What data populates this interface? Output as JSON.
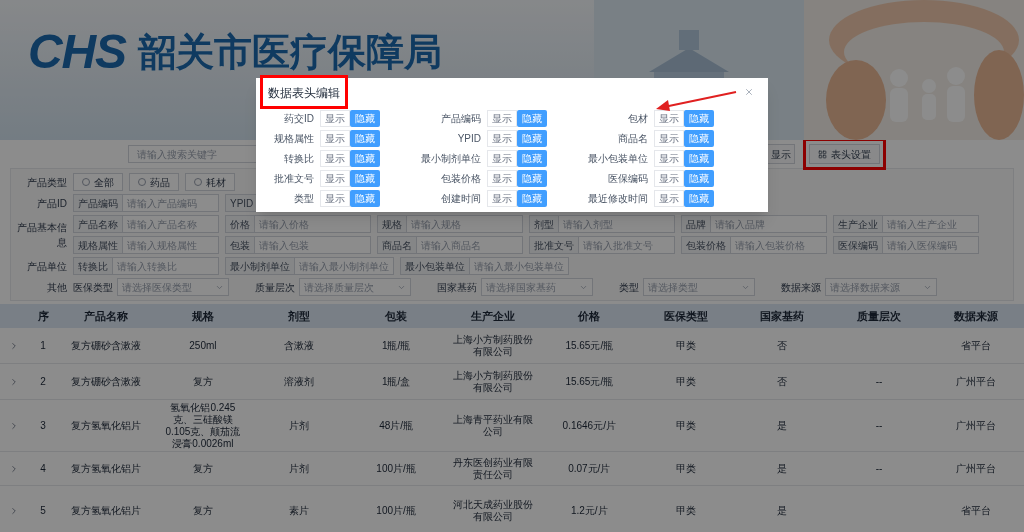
{
  "header": {
    "logo": "CHS",
    "title": "韶关市医疗保障局"
  },
  "toolbar": {
    "search": {
      "placeholder": "请输入搜索关键字"
    },
    "buttons": [
      {
        "kind": "plain",
        "label": "显示",
        "highlighted": false
      },
      {
        "kind": "columns",
        "label": "表头设置",
        "highlighted": true
      }
    ]
  },
  "filters": [
    {
      "kind": "radio",
      "label": "产品类型",
      "options": [
        {
          "label": "全部",
          "selected": false
        },
        {
          "label": "药品",
          "selected": false
        },
        {
          "label": "耗材",
          "selected": false
        }
      ]
    },
    {
      "kind": "inputs",
      "label": "产品ID",
      "lines": [
        [
          {
            "label": "产品编码",
            "placeholder": "请输入产品编码"
          },
          {
            "label": "YPID"
          }
        ]
      ]
    },
    {
      "kind": "inputs",
      "label": "产品基本信息",
      "lines": [
        [
          {
            "label": "产品名称",
            "placeholder": "请输入产品名称"
          },
          {
            "label": "价格",
            "placeholder": "请输入价格"
          },
          {
            "label": "规格",
            "placeholder": "请输入规格"
          },
          {
            "label": "剂型",
            "placeholder": "请输入剂型"
          },
          {
            "label": "品牌",
            "placeholder": "请输入品牌"
          },
          {
            "label": "生产企业",
            "placeholder": "请输入生产企业"
          }
        ],
        [
          {
            "label": "规格属性",
            "placeholder": "请输入规格属性"
          },
          {
            "label": "包装",
            "placeholder": "请输入包装"
          },
          {
            "label": "商品名",
            "placeholder": "请输入商品名"
          },
          {
            "label": "批准文号",
            "placeholder": "请输入批准文号"
          },
          {
            "label": "包装价格",
            "placeholder": "请输入包装价格"
          },
          {
            "label": "医保编码",
            "placeholder": "请输入医保编码"
          }
        ]
      ]
    },
    {
      "kind": "inputs",
      "label": "产品单位",
      "lines": [
        [
          {
            "label": "转换比",
            "placeholder": "请输入转换比"
          },
          {
            "label": "最小制剂单位",
            "placeholder": "请输入最小制剂单位"
          },
          {
            "label": "最小包装单位",
            "placeholder": "请输入最小包装单位"
          }
        ]
      ]
    },
    {
      "kind": "selects",
      "label": "其他",
      "fields": [
        {
          "label": "医保类型",
          "placeholder": "请选择医保类型"
        },
        {
          "label": "质量层次",
          "placeholder": "请选择质量层次"
        },
        {
          "label": "国家基药",
          "placeholder": "请选择国家基药"
        },
        {
          "label": "类型",
          "placeholder": "请选择类型"
        },
        {
          "label": "数据来源",
          "placeholder": "请选择数据来源"
        }
      ]
    }
  ],
  "table": {
    "columns": [
      "序",
      "产品名称",
      "规格",
      "剂型",
      "包装",
      "生产企业",
      "价格",
      "医保类型",
      "国家基药",
      "质量层次",
      "数据来源"
    ],
    "rows": [
      {
        "expanded": false,
        "cells": [
          "1",
          "复方硼砂含漱液",
          "250ml",
          "含漱液",
          "1瓶/瓶",
          "上海小方制药股份有限公司",
          "15.65元/瓶",
          "甲类",
          "否",
          "",
          "省平台"
        ]
      },
      {
        "expanded": false,
        "cells": [
          "2",
          "复方硼砂含漱液",
          "复方",
          "溶液剂",
          "1瓶/盒",
          "上海小方制药股份有限公司",
          "15.65元/瓶",
          "甲类",
          "否",
          "--",
          "广州平台"
        ]
      },
      {
        "expanded": false,
        "cells": [
          "3",
          "复方氢氧化铝片",
          "氢氧化铝0.245克、三硅酸镁0.105克、颠茄流浸膏0.0026ml",
          "片剂",
          "48片/瓶",
          "上海青平药业有限公司",
          "0.1646元/片",
          "甲类",
          "是",
          "--",
          "广州平台"
        ]
      },
      {
        "expanded": false,
        "cells": [
          "4",
          "复方氢氧化铝片",
          "复方",
          "片剂",
          "100片/瓶",
          "丹东医创药业有限责任公司",
          "0.07元/片",
          "甲类",
          "是",
          "--",
          "广州平台"
        ]
      },
      {
        "expanded": false,
        "cells": [
          "5",
          "复方氢氧化铝片",
          "复方",
          "素片",
          "100片/瓶",
          "河北天成药业股份有限公司",
          "1.2元/片",
          "甲类",
          "是",
          "",
          "省平台"
        ]
      }
    ]
  },
  "modal": {
    "title": "数据表头编辑",
    "title_highlighted": true,
    "fields": [
      {
        "label": "药交ID",
        "options": [
          {
            "label": "显示",
            "selected": false
          },
          {
            "label": "隐藏",
            "selected": true
          }
        ]
      },
      {
        "label": "产品编码",
        "options": [
          {
            "label": "显示",
            "selected": false
          },
          {
            "label": "隐藏",
            "selected": true
          }
        ]
      },
      {
        "label": "包材",
        "options": [
          {
            "label": "显示",
            "selected": false
          },
          {
            "label": "隐藏",
            "selected": true
          }
        ]
      },
      {
        "label": "规格属性",
        "options": [
          {
            "label": "显示",
            "selected": false
          },
          {
            "label": "隐藏",
            "selected": true
          }
        ]
      },
      {
        "label": "YPID",
        "options": [
          {
            "label": "显示",
            "selected": false
          },
          {
            "label": "隐藏",
            "selected": true
          }
        ]
      },
      {
        "label": "商品名",
        "options": [
          {
            "label": "显示",
            "selected": false
          },
          {
            "label": "隐藏",
            "selected": true
          }
        ]
      },
      {
        "label": "转换比",
        "options": [
          {
            "label": "显示",
            "selected": false
          },
          {
            "label": "隐藏",
            "selected": true
          }
        ]
      },
      {
        "label": "最小制剂单位",
        "options": [
          {
            "label": "显示",
            "selected": false
          },
          {
            "label": "隐藏",
            "selected": true
          }
        ]
      },
      {
        "label": "最小包装单位",
        "options": [
          {
            "label": "显示",
            "selected": false
          },
          {
            "label": "隐藏",
            "selected": true
          }
        ]
      },
      {
        "label": "批准文号",
        "options": [
          {
            "label": "显示",
            "selected": false
          },
          {
            "label": "隐藏",
            "selected": true
          }
        ]
      },
      {
        "label": "包装价格",
        "options": [
          {
            "label": "显示",
            "selected": false
          },
          {
            "label": "隐藏",
            "selected": true
          }
        ]
      },
      {
        "label": "医保编码",
        "options": [
          {
            "label": "显示",
            "selected": false
          },
          {
            "label": "隐藏",
            "selected": true
          }
        ]
      },
      {
        "label": "类型",
        "options": [
          {
            "label": "显示",
            "selected": false
          },
          {
            "label": "隐藏",
            "selected": true
          }
        ]
      },
      {
        "label": "创建时间",
        "options": [
          {
            "label": "显示",
            "selected": false
          },
          {
            "label": "隐藏",
            "selected": true
          }
        ]
      },
      {
        "label": "最近修改时间",
        "options": [
          {
            "label": "显示",
            "selected": false
          },
          {
            "label": "隐藏",
            "selected": true
          }
        ]
      }
    ]
  }
}
